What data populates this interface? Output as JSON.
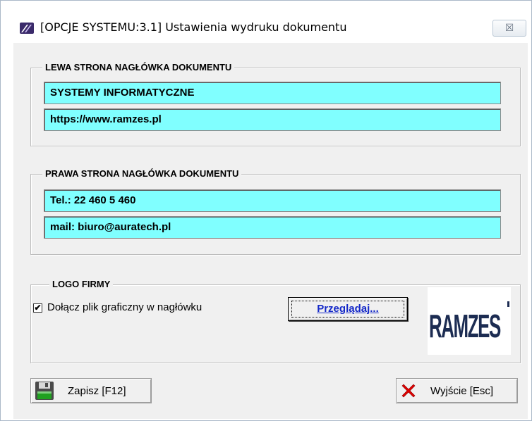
{
  "window": {
    "title": "[OPCJE SYSTEMU:3.1]  Ustawienia wydruku dokumentu",
    "close_glyph": "☒"
  },
  "left_header": {
    "title": "LEWA STRONA NAGŁÓWKA DOKUMENTU",
    "line1": "SYSTEMY INFORMATYCZNE",
    "line2": "https://www.ramzes.pl"
  },
  "right_header": {
    "title": "PRAWA STRONA NAGŁÓWKA DOKUMENTU",
    "line1": "Tel.: 22 460 5 460",
    "line2": "mail: biuro@auratech.pl"
  },
  "logo_group": {
    "title": "LOGO FIRMY",
    "attach_checked": true,
    "check_glyph": "✔",
    "attach_label": "Dołącz plik graficzny w nagłówku",
    "browse_label": "Przeglądaj...",
    "logo_text": "RAMZES"
  },
  "footer": {
    "save_label": "Zapisz  [F12]",
    "exit_label": "Wyjście  [Esc]",
    "save_icon": "floppy-disk-icon",
    "exit_icon": "red-x-icon"
  },
  "colors": {
    "field_bg": "#80ffff",
    "browse_text": "#1428c8",
    "exit_icon": "#e00000",
    "save_icon": "#20a020"
  }
}
